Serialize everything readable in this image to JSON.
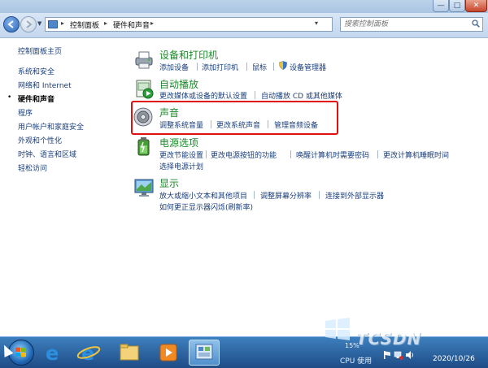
{
  "titlebar": {
    "min": "—",
    "max": "□",
    "close": "✕"
  },
  "address": {
    "crumbs": [
      "控制面板",
      "硬件和声音"
    ],
    "search_placeholder": "搜索控制面板"
  },
  "sidebar": {
    "items": [
      {
        "label": "控制面板主页",
        "active": false
      },
      {
        "label": "系统和安全",
        "active": false
      },
      {
        "label": "网络和 Internet",
        "active": false
      },
      {
        "label": "硬件和声音",
        "active": true
      },
      {
        "label": "程序",
        "active": false
      },
      {
        "label": "用户帐户和家庭安全",
        "active": false
      },
      {
        "label": "外观和个性化",
        "active": false
      },
      {
        "label": "时钟、语言和区域",
        "active": false
      },
      {
        "label": "轻松访问",
        "active": false
      }
    ]
  },
  "categories": [
    {
      "title": "设备和打印机",
      "icon": "printer-icon",
      "links": [
        "添加设备",
        "添加打印机",
        "鼠标",
        "设备管理器"
      ]
    },
    {
      "title": "自动播放",
      "icon": "autoplay-icon",
      "links": [
        "更改媒体或设备的默认设置",
        "自动播放 CD 或其他媒体"
      ]
    },
    {
      "title": "声音",
      "icon": "speaker-icon",
      "links": [
        "调整系统音量",
        "更改系统声音",
        "管理音频设备"
      ]
    },
    {
      "title": "电源选项",
      "icon": "battery-icon",
      "links": [
        "更改节能设置",
        "更改电源按钮的功能",
        "唤醒计算机时需要密码",
        "更改计算机睡眠时间",
        "选择电源计划"
      ]
    },
    {
      "title": "显示",
      "icon": "monitor-icon",
      "links": [
        "放大或缩小文本和其他项目",
        "调整屏幕分辨率",
        "连接到外部显示器",
        "如何更正显示器闪烁(刷新率)"
      ]
    }
  ],
  "taskbar": {
    "cpu_percent": "15%",
    "cpu_label": "CPU 使用",
    "brand": "TCSDN",
    "date": "2020/10/26"
  },
  "colors": {
    "link": "#1a3e7d",
    "category_title": "#1c8a2a",
    "highlight": "#e01010"
  }
}
